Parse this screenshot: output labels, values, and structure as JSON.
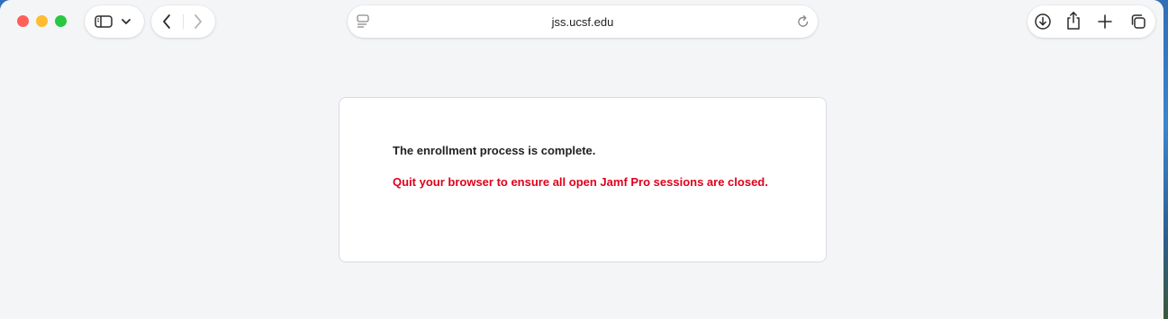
{
  "browser": {
    "url": "jss.ucsf.edu",
    "icons": {
      "sidebar": "sidebar-icon",
      "sidebar_menu": "chevron-down-icon",
      "back": "chevron-left-icon",
      "forward": "chevron-right-icon",
      "page_menu": "page-menu-icon",
      "reload": "reload-icon",
      "downloads": "download-icon",
      "share": "share-icon",
      "new_tab": "plus-icon",
      "tabs_overview": "tabs-overview-icon"
    }
  },
  "page": {
    "message": "The enrollment process is complete.",
    "warning": "Quit your browser to ensure all open Jamf Pro sessions are closed.",
    "warning_color": "#e0001b"
  }
}
